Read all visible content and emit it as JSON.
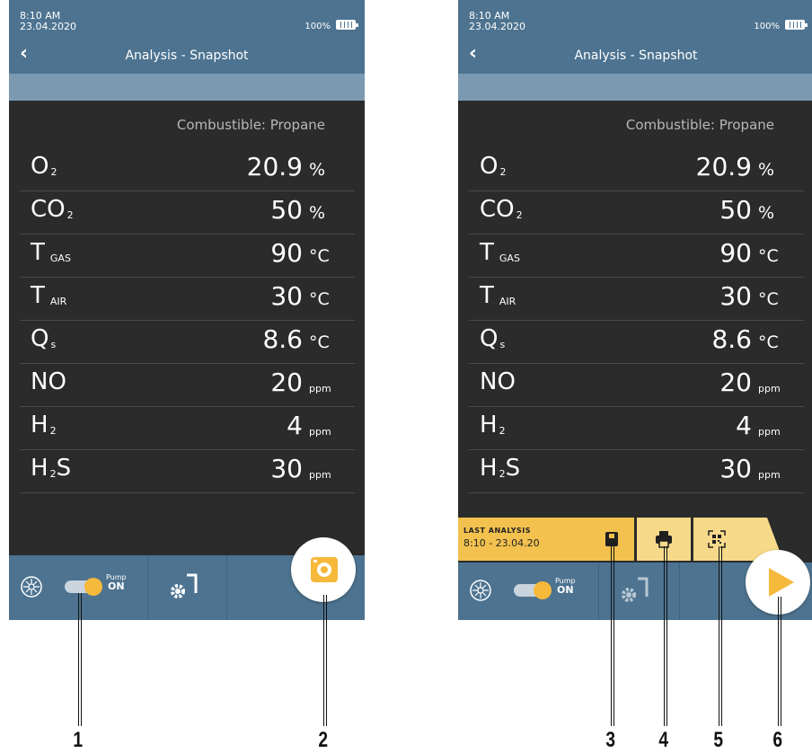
{
  "left_screen": {
    "time": "8:10 AM",
    "date": "23.04.2020",
    "battery": "100%",
    "title": "Analysis - Snapshot",
    "combustible": "Combustible: Propane",
    "rows": [
      {
        "name": "O",
        "sub": "2",
        "value": "20.9",
        "unit": "%"
      },
      {
        "name": "CO",
        "sub": "2",
        "value": "50",
        "unit": "%"
      },
      {
        "name": "T",
        "sub": "GAS",
        "value": "90",
        "unit": "°C"
      },
      {
        "name": "T",
        "sub": "AIR",
        "value": "30",
        "unit": "°C"
      },
      {
        "name": "Q",
        "sub": "s",
        "value": "8.6",
        "unit": "°C"
      },
      {
        "name": "NO",
        "sub": "",
        "value": "20",
        "unit": "ppm"
      },
      {
        "name": "H",
        "sub": "2",
        "value": "4",
        "unit": "ppm"
      },
      {
        "name": "H",
        "sub": "2",
        "name_after": "S",
        "value": "30",
        "unit": "ppm"
      }
    ],
    "pump_label": "Pump",
    "pump_state": "ON"
  },
  "right_screen": {
    "time": "8:10 AM",
    "date": "23.04.2020",
    "battery": "100%",
    "title": "Analysis - Snapshot",
    "combustible": "Combustible: Propane",
    "rows": [
      {
        "name": "O",
        "sub": "2",
        "value": "20.9",
        "unit": "%"
      },
      {
        "name": "CO",
        "sub": "2",
        "value": "50",
        "unit": "%"
      },
      {
        "name": "T",
        "sub": "GAS",
        "value": "90",
        "unit": "°C"
      },
      {
        "name": "T",
        "sub": "AIR",
        "value": "30",
        "unit": "°C"
      },
      {
        "name": "Q",
        "sub": "s",
        "value": "8.6",
        "unit": "°C"
      },
      {
        "name": "NO",
        "sub": "",
        "value": "20",
        "unit": "ppm"
      },
      {
        "name": "H",
        "sub": "2",
        "value": "4",
        "unit": "ppm"
      },
      {
        "name": "H",
        "sub": "2",
        "name_after": "S",
        "value": "30",
        "unit": "ppm"
      }
    ],
    "last_analysis_label": "LAST ANALYSIS",
    "last_analysis_time": "8:10 - 23.04.20",
    "pump_label": "Pump",
    "pump_state": "ON"
  },
  "callouts": [
    "1",
    "2",
    "3",
    "4",
    "5",
    "6"
  ],
  "colors": {
    "header": "#4d7390",
    "accent": "#f6b93b",
    "background": "#2b2b2b"
  },
  "icons": [
    "back-chevron-icon",
    "battery-icon",
    "pump-fan-icon",
    "probe-settings-icon",
    "camera-icon",
    "save-icon",
    "print-icon",
    "qr-code-icon",
    "play-icon"
  ]
}
